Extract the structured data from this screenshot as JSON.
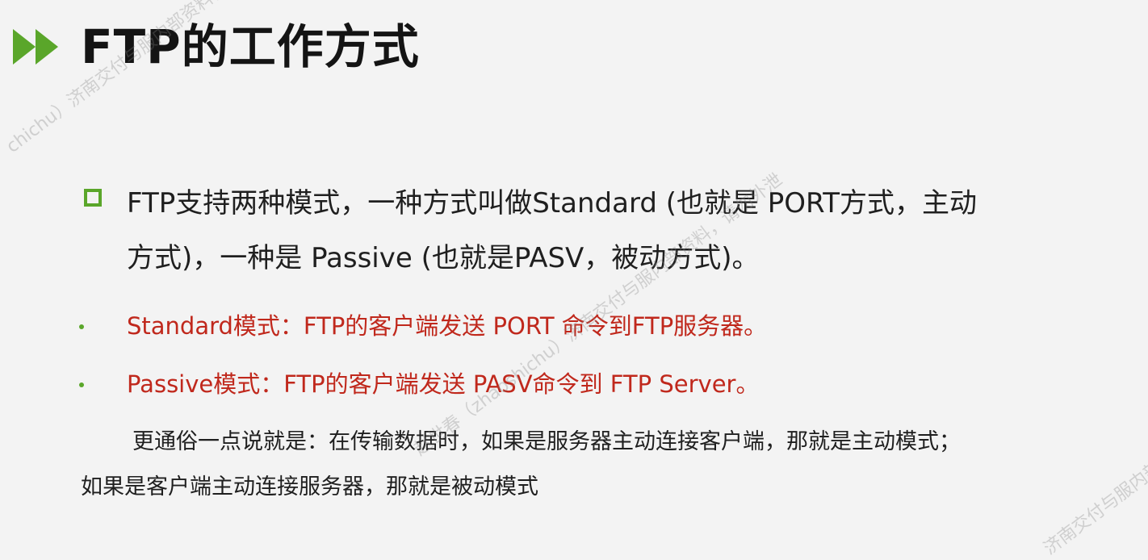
{
  "title": "FTP的工作方式",
  "title_icon": "double-chevron-right-icon",
  "accent_color": "#5aa62a",
  "highlight_color": "#c0281c",
  "main_bullet": {
    "icon": "square-bullet-icon",
    "lines": [
      "FTP支持两种模式，一种方式叫做Standard (也就是 PORT方式，主动",
      "方式)，一种是 Passive (也就是PASV，被动方式)。"
    ]
  },
  "sub_bullets": [
    "Standard模式：FTP的客户端发送 PORT 命令到FTP服务器。",
    "Passive模式：FTP的客户端发送 PASV命令到 FTP Server。"
  ],
  "note": {
    "lines": [
      "更通俗一点说就是：在传输数据时，如果是服务器主动连接客户端，那就是主动模式；",
      "如果是客户端主动连接服务器，那就是被动模式"
    ]
  },
  "watermarks": [
    "chichu）济南交付与服内部资料，请",
    "赵世春（zhaoshichu）济南交付与服内部资料，请勿外泄",
    "济南交付与服内部资"
  ]
}
